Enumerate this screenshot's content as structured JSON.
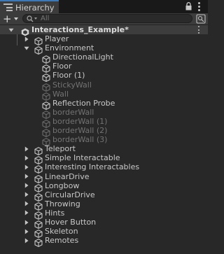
{
  "tab": {
    "title": "Hierarchy"
  },
  "toolbar": {
    "create_label": "+",
    "search_placeholder": "All"
  },
  "tree": [
    {
      "label": "Interactions_Example*",
      "type": "scene",
      "expanded": true,
      "bold": true
    },
    {
      "label": "Player",
      "depth": 1,
      "expanded": false
    },
    {
      "label": "Environment",
      "depth": 1,
      "expanded": true
    },
    {
      "label": "DirectionalLight",
      "depth": 2
    },
    {
      "label": "Floor",
      "depth": 2
    },
    {
      "label": "Floor (1)",
      "depth": 2
    },
    {
      "label": "StickyWall",
      "depth": 2,
      "inactive": true
    },
    {
      "label": "Wall",
      "depth": 2,
      "inactive": true
    },
    {
      "label": "Reflection Probe",
      "depth": 2
    },
    {
      "label": "borderWall",
      "depth": 2,
      "inactive": true
    },
    {
      "label": "borderWall (1)",
      "depth": 2,
      "inactive": true
    },
    {
      "label": "borderWall (2)",
      "depth": 2,
      "inactive": true
    },
    {
      "label": "borderWall (3)",
      "depth": 2,
      "inactive": true
    },
    {
      "label": "Teleport",
      "depth": 1,
      "expanded": false
    },
    {
      "label": "Simple Interactable",
      "depth": 1,
      "expanded": false
    },
    {
      "label": "Interesting Interactables",
      "depth": 1,
      "expanded": false
    },
    {
      "label": "LinearDrive",
      "depth": 1,
      "expanded": false
    },
    {
      "label": "Longbow",
      "depth": 1,
      "expanded": false
    },
    {
      "label": "CircularDrive",
      "depth": 1,
      "expanded": false
    },
    {
      "label": "Throwing",
      "depth": 1,
      "expanded": false
    },
    {
      "label": "Hints",
      "depth": 1,
      "expanded": false
    },
    {
      "label": "Hover Button",
      "depth": 1,
      "expanded": false
    },
    {
      "label": "Skeleton",
      "depth": 1,
      "expanded": false
    },
    {
      "label": "Remotes",
      "depth": 1,
      "expanded": false
    }
  ],
  "colors": {
    "accent": "#3a79bb",
    "panel_bg": "#282828",
    "text": "#c8c8c8",
    "inactive_text": "#737373"
  },
  "icons": {
    "tab": "hierarchy-icon",
    "lock": "lock-icon",
    "menu": "kebab-menu-icon",
    "search": "search-icon",
    "scene": "unity-scene-icon",
    "object": "gameobject-cube-icon",
    "scene_visibility": "scene-visibility-icon"
  }
}
